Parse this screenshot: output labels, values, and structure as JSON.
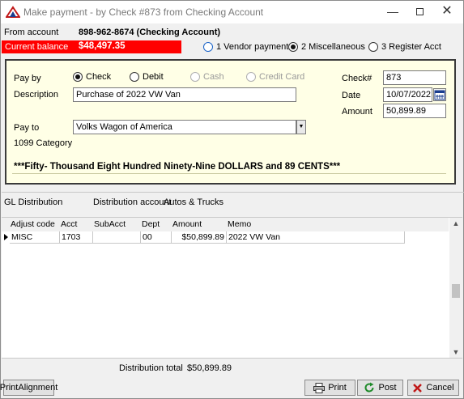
{
  "window": {
    "title": "Make payment - by Check #873 from Checking Account",
    "minimize": "—",
    "close": "✕"
  },
  "header": {
    "from_account_label": "From account",
    "from_account_value": "898-962-8674 (Checking Account)",
    "current_balance_label": "Current balance",
    "current_balance_value": "$48,497.35",
    "payment_types": [
      {
        "label": "1 Vendor payment",
        "selected": false
      },
      {
        "label": "2 Miscellaneous",
        "selected": true
      },
      {
        "label": "3 Register Acct",
        "selected": false
      }
    ]
  },
  "check": {
    "pay_by_label": "Pay by",
    "methods": [
      {
        "label": "Check",
        "selected": true,
        "enabled": true
      },
      {
        "label": "Debit",
        "selected": false,
        "enabled": true
      },
      {
        "label": "Cash",
        "selected": false,
        "enabled": false
      },
      {
        "label": "Credit Card",
        "selected": false,
        "enabled": false
      }
    ],
    "description_label": "Description",
    "description_value": "Purchase of 2022 VW Van",
    "pay_to_label": "Pay to",
    "pay_to_value": "Volks Wagon of America",
    "category_label": "1099 Category",
    "check_no_label": "Check#",
    "check_no_value": "873",
    "date_label": "Date",
    "date_value": "10/07/2022",
    "amount_label": "Amount",
    "amount_value": "50,899.89",
    "amount_words": "***Fifty- Thousand Eight Hundred Ninety-Nine DOLLARS and 89 CENTS***"
  },
  "distribution": {
    "gl_label": "GL Distribution",
    "account_label": "Distribution account",
    "account_value": "Autos & Trucks",
    "columns": [
      "Adjust code",
      "Acct",
      "SubAcct",
      "Dept",
      "Amount",
      "Memo"
    ],
    "rows": [
      {
        "adjust_code": "MISC",
        "acct": "1703",
        "subacct": "",
        "dept": "00",
        "amount": "$50,899.89",
        "memo": "2022 VW Van"
      }
    ],
    "total_label": "Distribution total",
    "total_value": "$50,899.89"
  },
  "footer": {
    "print_alignment": "PrintAlignment",
    "print": "Print",
    "post": "Post",
    "cancel": "Cancel"
  },
  "colors": {
    "balance_bg": "#ff0000",
    "panel_bg": "#ffffe6",
    "post_icon": "#1f8a2a",
    "cancel_icon": "#c01818"
  }
}
